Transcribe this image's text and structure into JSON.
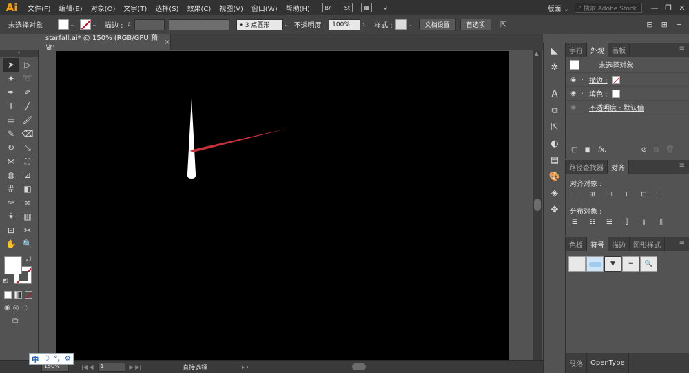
{
  "app": {
    "logo": "Ai"
  },
  "menu": [
    "文件(F)",
    "编辑(E)",
    "对象(O)",
    "文字(T)",
    "选择(S)",
    "效果(C)",
    "视图(V)",
    "窗口(W)",
    "帮助(H)"
  ],
  "menubar_icons": [
    "Br",
    "St"
  ],
  "workspace": "版面 ⌄",
  "stock_search": {
    "placeholder": "搜索 Adobe Stock"
  },
  "control": {
    "selection": "未选择对象",
    "stroke_label": "描边 :",
    "brush": "• 3 点圆形",
    "opacity_label": "不透明度 :",
    "opacity_value": "100%",
    "style_label": "样式 :",
    "doc_setup": "文档设置",
    "prefs": "首选项"
  },
  "document": {
    "tab_title": "starfall.ai* @ 150% (RGB/GPU 预览)",
    "close": "×"
  },
  "status": {
    "zoom": "150%",
    "page": "1",
    "tool": "直接选择"
  },
  "ime": [
    "中",
    "☽",
    "°,",
    "⚙"
  ],
  "appearance_panel": {
    "tabs": [
      "字符",
      "外观",
      "画板"
    ],
    "active_tab": "外观",
    "header": "未选择对象",
    "stroke_label": "描边 :",
    "fill_label": "填色 :",
    "opacity_row": "不透明度 : 默认值"
  },
  "align_panel": {
    "tabs": [
      "路径查找器",
      "对齐"
    ],
    "active_tab": "对齐",
    "align_objects": "对齐对象 :",
    "distribute_objects": "分布对象 :"
  },
  "symbol_panel": {
    "tabs": [
      "色板",
      "符号",
      "描边",
      "图形样式"
    ],
    "active_tab": "符号"
  },
  "bottom_tabs": [
    "段落",
    "OpenType"
  ],
  "colors": {
    "accent_red": "#c8303a",
    "shape_white": "#ffffff",
    "artboard": "#000000"
  }
}
